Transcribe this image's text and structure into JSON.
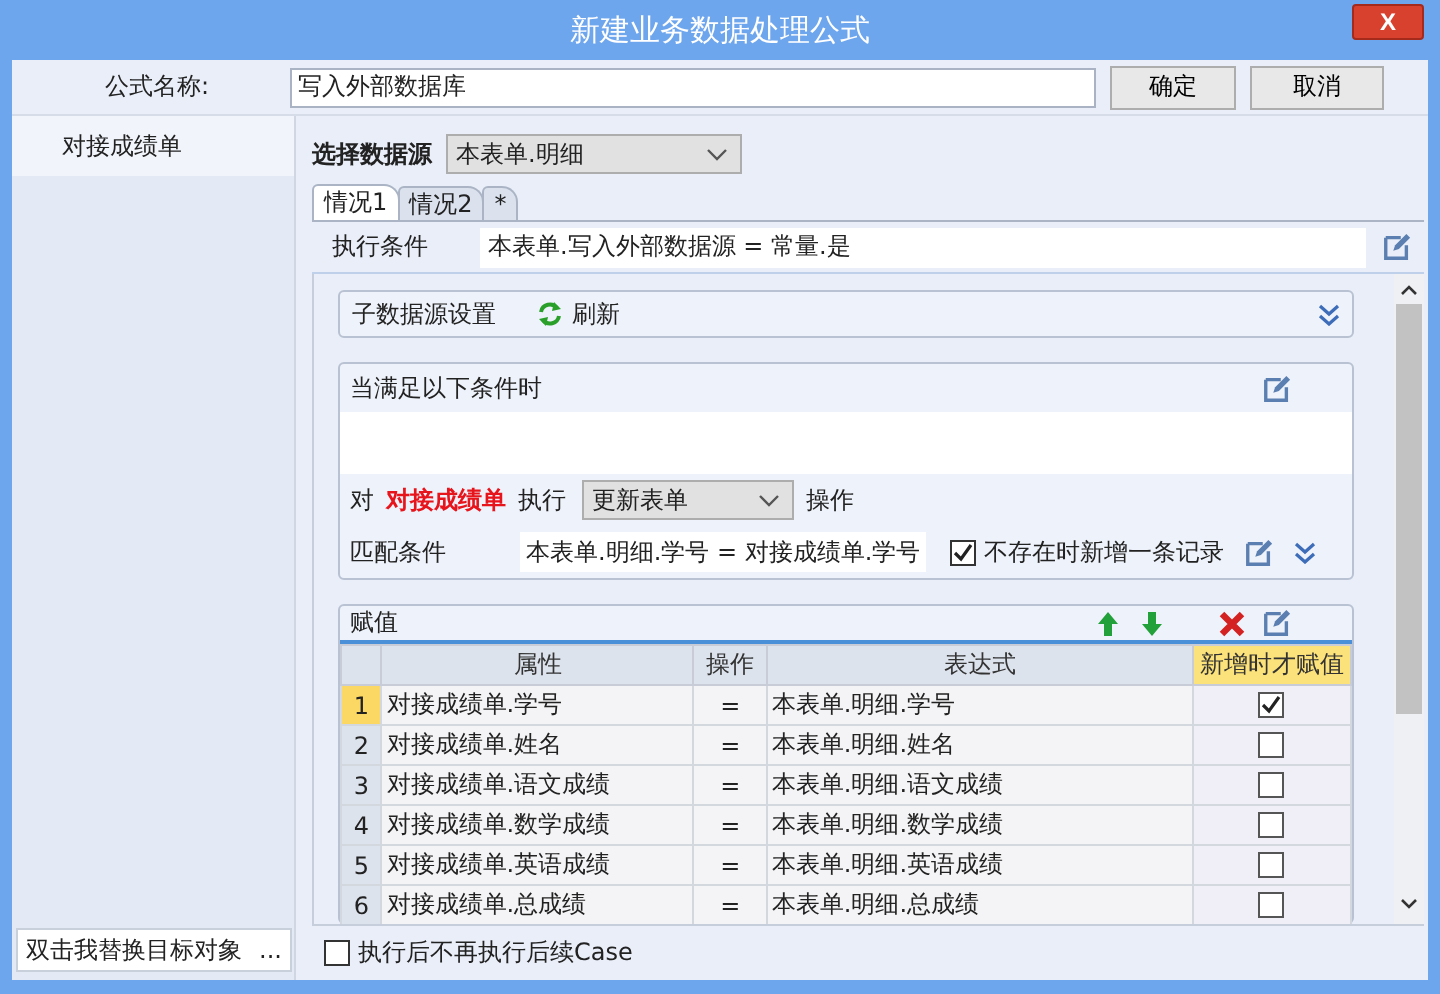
{
  "window": {
    "title": "新建业务数据处理公式",
    "close_label": "X"
  },
  "formula_name": {
    "label": "公式名称:",
    "value": "写入外部数据库"
  },
  "buttons": [
    "确定",
    "取消"
  ],
  "sidebar": {
    "items": [
      {
        "label": "对接成绩单",
        "selected": true
      }
    ],
    "replace_field": {
      "value": "双击我替换目标对象",
      "button": "..."
    }
  },
  "data_source": {
    "label": "选择数据源",
    "value": "本表单.明细"
  },
  "tabs": [
    {
      "label": "情况1",
      "selected": true
    },
    {
      "label": "情况2",
      "selected": false
    },
    {
      "label": "*",
      "selected": false
    }
  ],
  "condition": {
    "label": "执行条件",
    "value": "本表单.写入外部数据源 = 常量.是"
  },
  "sub_source": {
    "label": "子数据源设置",
    "refresh": "刷新"
  },
  "when": {
    "title": "当满足以下条件时",
    "target_prefix": "对",
    "target": "对接成绩单",
    "exec_label": "执行",
    "action": "更新表单",
    "op_label": "操作",
    "match_label": "匹配条件",
    "match_value": "本表单.明细.学号 = 对接成绩单.学号",
    "insert_if_missing": {
      "label": "不存在时新增一条记录",
      "checked": true
    }
  },
  "assign": {
    "title": "赋值",
    "columns": [
      {
        "label": "属性",
        "selected": false
      },
      {
        "label": "操作",
        "selected": false
      },
      {
        "label": "表达式",
        "selected": false
      },
      {
        "label": "新增时才赋值",
        "selected": true
      }
    ],
    "rows": [
      {
        "num": "1",
        "property": "对接成绩单.学号",
        "op": "=",
        "expr": "本表单.明细.学号",
        "insert_only": true,
        "selected": true
      },
      {
        "num": "2",
        "property": "对接成绩单.姓名",
        "op": "=",
        "expr": "本表单.明细.姓名",
        "insert_only": false,
        "selected": false
      },
      {
        "num": "3",
        "property": "对接成绩单.语文成绩",
        "op": "=",
        "expr": "本表单.明细.语文成绩",
        "insert_only": false,
        "selected": false
      },
      {
        "num": "4",
        "property": "对接成绩单.数学成绩",
        "op": "=",
        "expr": "本表单.明细.数学成绩",
        "insert_only": false,
        "selected": false
      },
      {
        "num": "5",
        "property": "对接成绩单.英语成绩",
        "op": "=",
        "expr": "本表单.明细.英语成绩",
        "insert_only": false,
        "selected": false
      },
      {
        "num": "6",
        "property": "对接成绩单.总成绩",
        "op": "=",
        "expr": "本表单.明细.总成绩",
        "insert_only": false,
        "selected": false
      }
    ]
  },
  "stop_after": {
    "label": "执行后不再执行后续Case",
    "checked": false
  }
}
